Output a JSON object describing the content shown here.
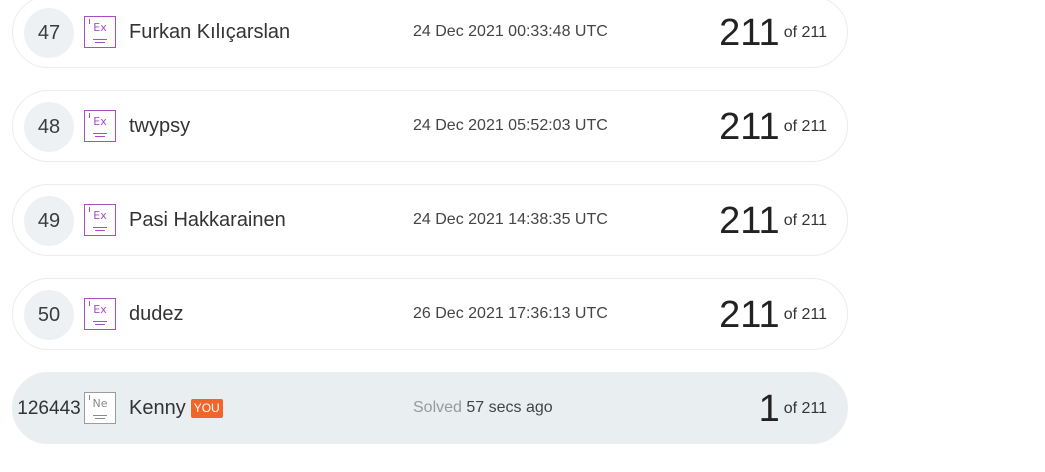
{
  "rows": [
    {
      "rank": "47",
      "level_symbol": "Ex",
      "name": "Furkan Kılıçarslan",
      "date": "24 Dec 2021 00:33:48 UTC",
      "score": "211",
      "of_total": "of 211"
    },
    {
      "rank": "48",
      "level_symbol": "Ex",
      "name": "twypsy",
      "date": "24 Dec 2021 05:52:03 UTC",
      "score": "211",
      "of_total": "of 211"
    },
    {
      "rank": "49",
      "level_symbol": "Ex",
      "name": "Pasi Hakkarainen",
      "date": "24 Dec 2021 14:38:35 UTC",
      "score": "211",
      "of_total": "of 211"
    },
    {
      "rank": "50",
      "level_symbol": "Ex",
      "name": "dudez",
      "date": "26 Dec 2021 17:36:13 UTC",
      "score": "211",
      "of_total": "of 211"
    }
  ],
  "you_row": {
    "rank": "126443",
    "level_symbol": "Ne",
    "name": "Kenny",
    "badge": "YOU",
    "solved_label": "Solved",
    "solved_time": "57 secs ago",
    "score": "1",
    "of_total": "of 211"
  },
  "colors": {
    "level_ex": "#a64ec4",
    "level_ne": "#9c9c9c",
    "you_badge": "#f26529",
    "you_row_bg": "#e9eef1"
  },
  "icons": {
    "level_ex": "level-ex-icon",
    "level_ne": "level-ne-icon"
  }
}
